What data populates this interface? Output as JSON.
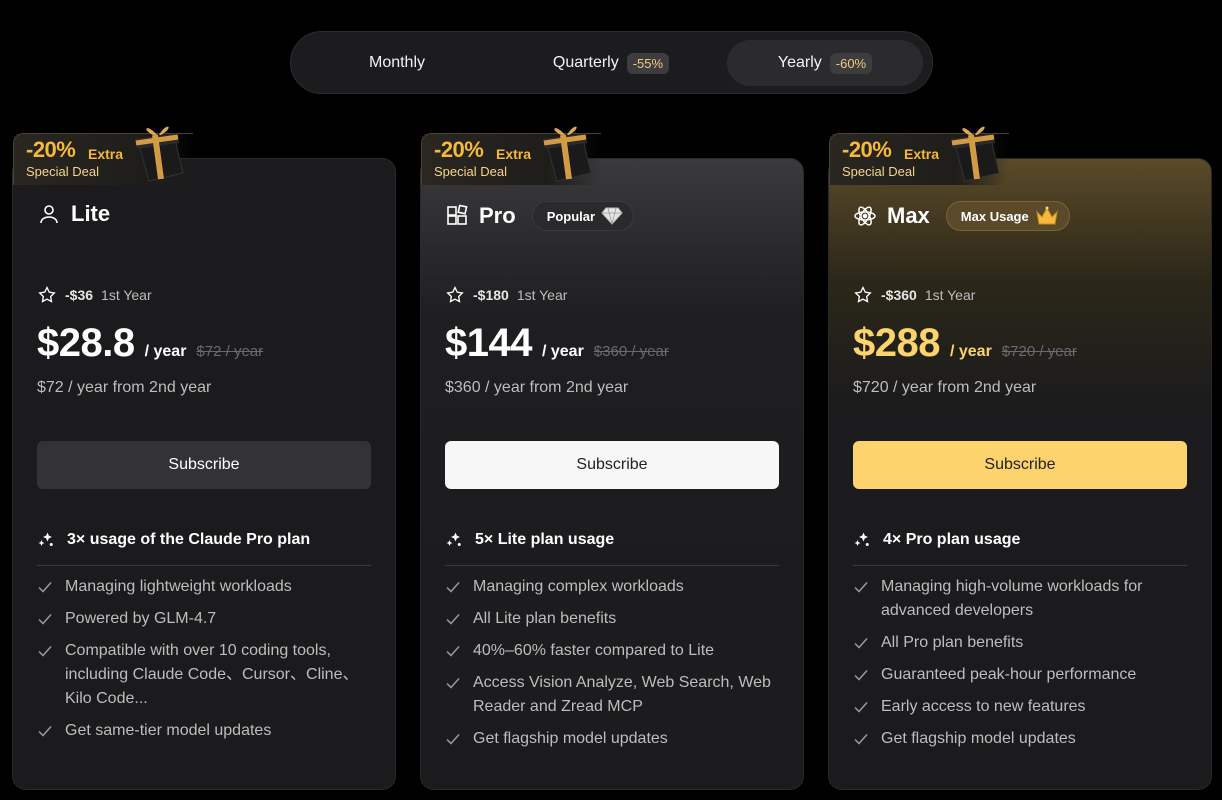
{
  "billing_toggle": {
    "options": [
      {
        "label": "Monthly",
        "badge": ""
      },
      {
        "label": "Quarterly",
        "badge": "-55%"
      },
      {
        "label": "Yearly",
        "badge": "-60%"
      }
    ],
    "selected": "Yearly"
  },
  "ribbon": {
    "percent": "-20%",
    "extra": "Extra",
    "deal": "Special Deal"
  },
  "colors": {
    "accent_gold": "#fdd36e",
    "ribbon_orange": "#f6b93b",
    "background": "#000000",
    "card": "#1b1b1d"
  },
  "plans": [
    {
      "name": "Lite",
      "icon": "user-icon",
      "tag": "",
      "discount_amount": "-$36",
      "discount_period": "1st Year",
      "price": "$28.8",
      "per": "/ year",
      "original": "$72 / year",
      "renewal": "$72 / year from 2nd year",
      "button_label": "Subscribe",
      "headline": "3× usage of the Claude Pro plan",
      "features": [
        "Managing lightweight workloads",
        "Powered by GLM-4.7",
        "Compatible with over 10 coding tools, including Claude Code、Cursor、Cline、Kilo Code...",
        "Get same-tier model updates"
      ]
    },
    {
      "name": "Pro",
      "icon": "grid-icon",
      "tag": "Popular",
      "tag_icon": "diamond-icon",
      "discount_amount": "-$180",
      "discount_period": "1st Year",
      "price": "$144",
      "per": "/ year",
      "original": "$360 / year",
      "renewal": "$360 / year from 2nd year",
      "button_label": "Subscribe",
      "headline": "5× Lite plan usage",
      "features": [
        "Managing complex workloads",
        "All Lite plan benefits",
        "40%–60% faster compared to Lite",
        "Access Vision Analyze, Web Search, Web Reader and Zread MCP",
        "Get flagship model updates"
      ]
    },
    {
      "name": "Max",
      "icon": "atom-icon",
      "tag": "Max Usage",
      "tag_icon": "crown-icon",
      "discount_amount": "-$360",
      "discount_period": "1st Year",
      "price": "$288",
      "per": "/ year",
      "original": "$720 / year",
      "renewal": "$720 / year from 2nd year",
      "button_label": "Subscribe",
      "headline": "4× Pro plan usage",
      "features": [
        "Managing high-volume workloads for advanced developers",
        "All Pro plan benefits",
        "Guaranteed peak-hour performance",
        "Early access to new features",
        "Get flagship model updates"
      ]
    }
  ]
}
